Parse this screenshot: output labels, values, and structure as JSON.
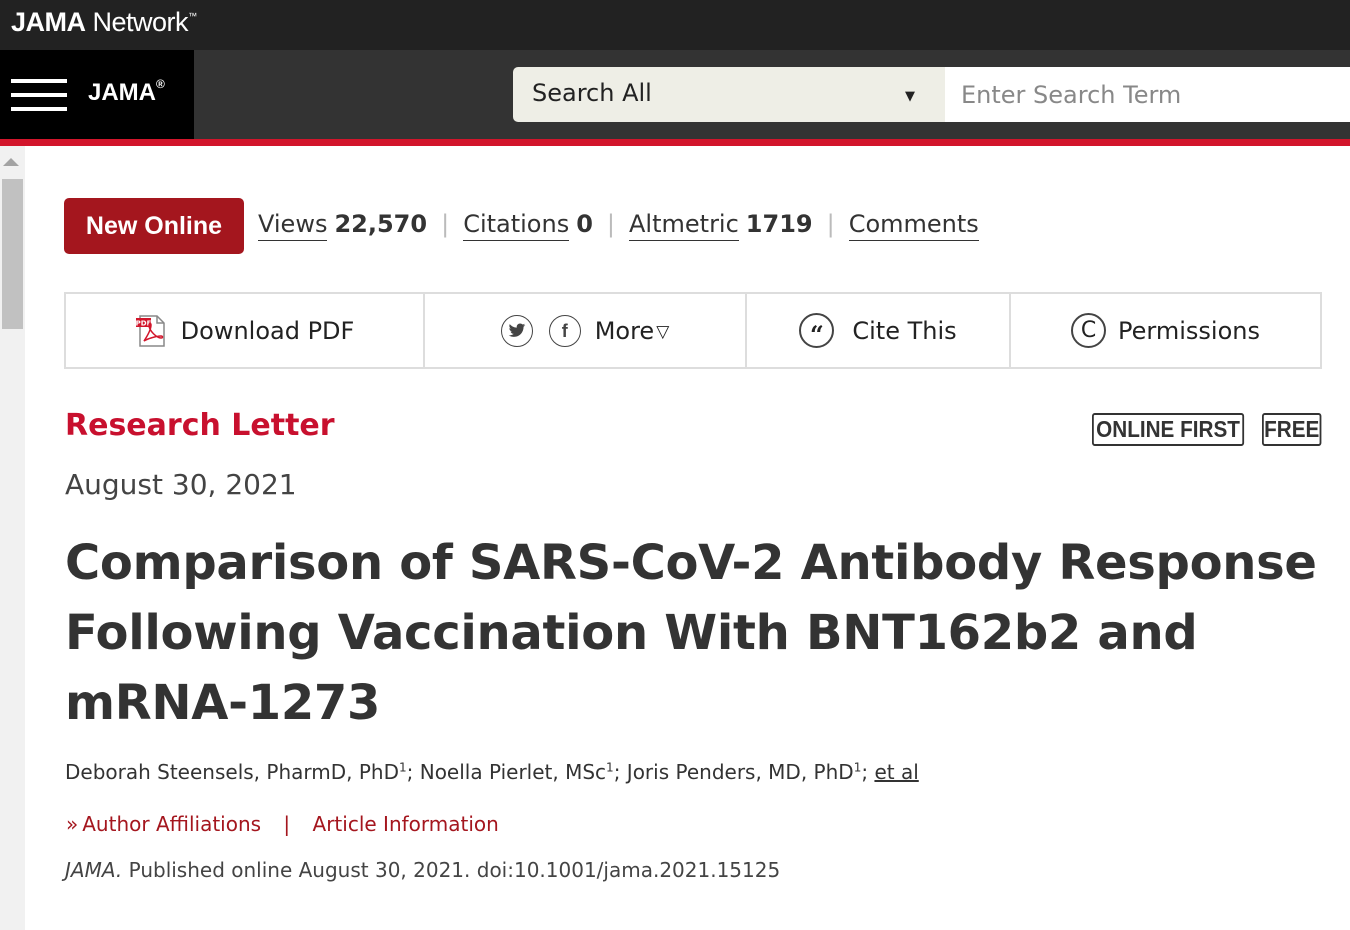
{
  "network": {
    "logo_bold": "JAMA",
    "logo_light": "Network",
    "tm": "™"
  },
  "journal": {
    "name": "JAMA",
    "reg": "®"
  },
  "search": {
    "scope": "Search All",
    "placeholder": "Enter Search Term"
  },
  "badge": {
    "label": "New Online"
  },
  "metrics": [
    {
      "label": "Views",
      "value": "22,570"
    },
    {
      "label": "Citations",
      "value": "0"
    },
    {
      "label": "Altmetric",
      "value": "1719"
    },
    {
      "label": "Comments",
      "value": ""
    }
  ],
  "separator": "|",
  "toolbar": {
    "download_pdf": "Download PDF",
    "more": "More",
    "cite_this": "Cite This",
    "permissions": "Permissions"
  },
  "article": {
    "type": "Research Letter",
    "pill_online_first": "ONLINE FIRST",
    "pill_free": "FREE",
    "date": "August 30, 2021",
    "title": "Comparison of SARS-CoV-2 Antibody Response Following Vaccination With BNT162b2 and mRNA-1273",
    "authors": [
      {
        "name": "Deborah Steensels, PharmD, PhD",
        "aff": "1"
      },
      {
        "name": "Noella Pierlet, MSc",
        "aff": "1"
      },
      {
        "name": "Joris Penders, MD, PhD",
        "aff": "1"
      }
    ],
    "et_al": "et al",
    "author_affiliations": "Author Affiliations",
    "link_divider": "|",
    "article_information": "Article Information",
    "citation_journal": "JAMA.",
    "citation_rest": "Published online August 30, 2021. doi:10.1001/jama.2021.15125"
  },
  "colors": {
    "brand_red": "#d2152b",
    "badge_red": "#a4161e",
    "dark_bar": "#333333"
  },
  "icons": [
    "menu-icon",
    "dropdown-caret-icon",
    "pdf-icon",
    "twitter-icon",
    "facebook-icon",
    "more-caret-icon",
    "quote-icon",
    "copyright-icon",
    "chevron-right-icon"
  ]
}
